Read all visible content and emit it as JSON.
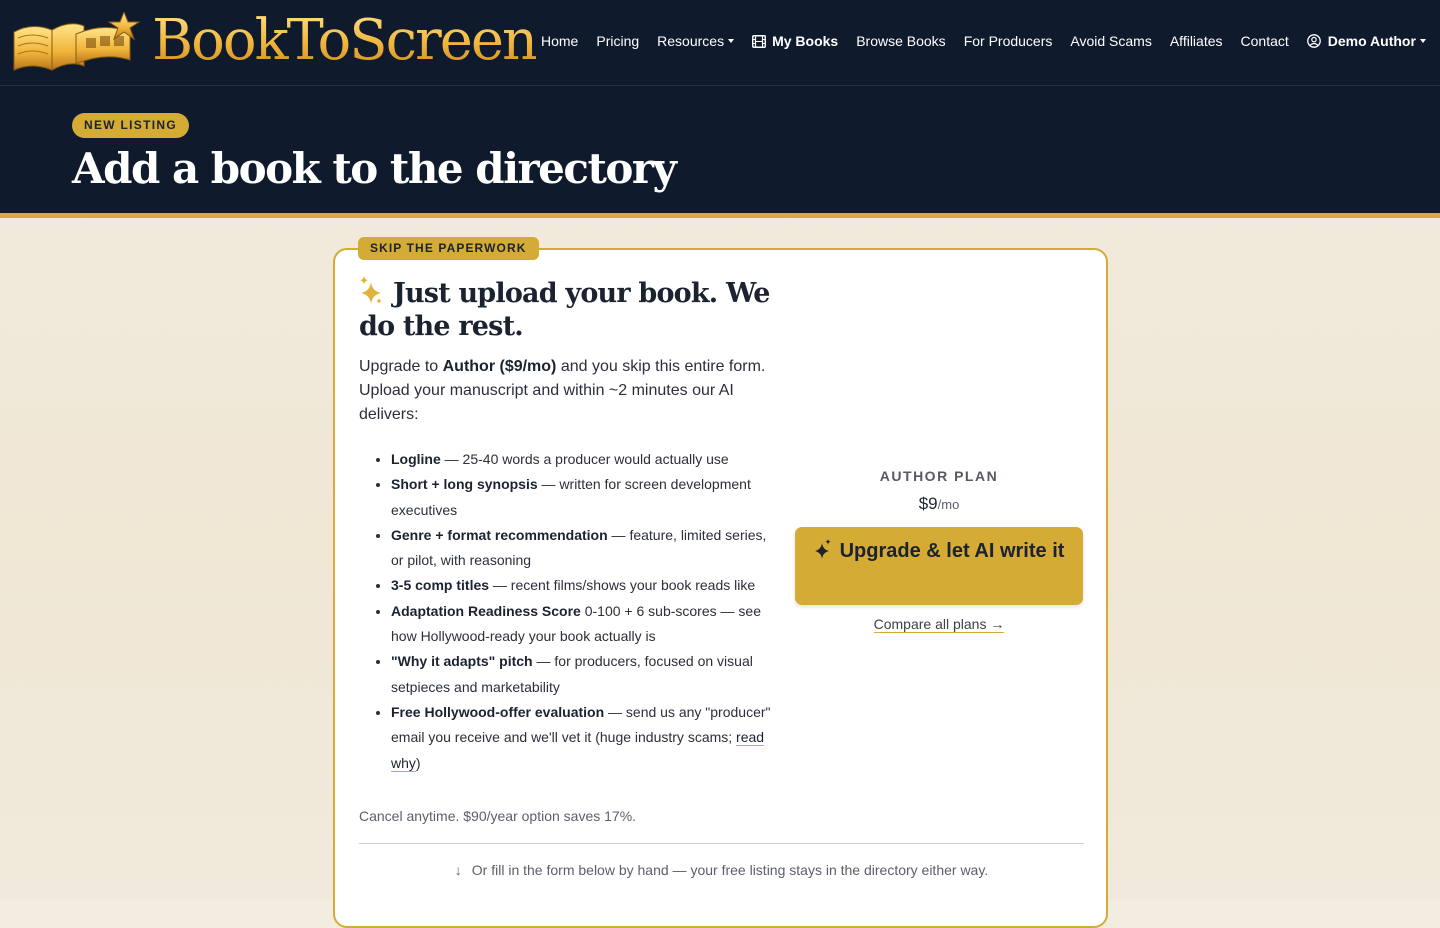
{
  "brand": {
    "name": "BookToScreen"
  },
  "nav": {
    "items": [
      {
        "label": "Home"
      },
      {
        "label": "Pricing"
      },
      {
        "label": "Resources"
      },
      {
        "label": "My Books"
      },
      {
        "label": "Browse Books"
      },
      {
        "label": "For Producers"
      },
      {
        "label": "Avoid Scams"
      },
      {
        "label": "Affiliates"
      },
      {
        "label": "Contact"
      }
    ],
    "user": {
      "label": "Demo Author"
    }
  },
  "hero": {
    "badge": "NEW LISTING",
    "title": "Add a book to the directory"
  },
  "card": {
    "tag": "SKIP THE PAPERWORK",
    "title": "Just upload your book. We do the rest.",
    "intro_prefix": "Upgrade to ",
    "intro_plan": "Author ($9/mo)",
    "intro_suffix": " and you skip this entire form. Upload your manuscript and within ~2 minutes our AI delivers:",
    "features": [
      {
        "title": "Logline",
        "text": " — 25-40 words a producer would actually use"
      },
      {
        "title": "Short + long synopsis",
        "text": " — written for screen development executives"
      },
      {
        "title": "Genre + format recommendation",
        "text": " — feature, limited series, or pilot, with reasoning"
      },
      {
        "title": "3-5 comp titles",
        "text": " — recent films/shows your book reads like"
      },
      {
        "title": "Adaptation Readiness Score",
        "text": " 0-100 + 6 sub-scores — see how Hollywood-ready your book actually is"
      },
      {
        "title": "\"Why it adapts\" pitch",
        "text": " — for producers, focused on visual setpieces and marketability"
      },
      {
        "title": "Free Hollywood-offer evaluation",
        "text": " — send us any \"producer\" email you receive and we'll vet it (huge industry scams; ",
        "link": "read why",
        "tail": ")"
      }
    ],
    "cancel_note": "Cancel anytime. $90/year option saves 17%.",
    "fill_note": "Or fill in the form below by hand — your free listing stays in the directory either way."
  },
  "plan": {
    "label": "AUTHOR PLAN",
    "price": "$9",
    "period": "/mo",
    "button": "Upgrade & let AI write it",
    "compare": "Compare all plans →"
  },
  "colors": {
    "navy": "#0f1b2d",
    "gold": "#d4ab35",
    "cream": "#f3ede1"
  }
}
